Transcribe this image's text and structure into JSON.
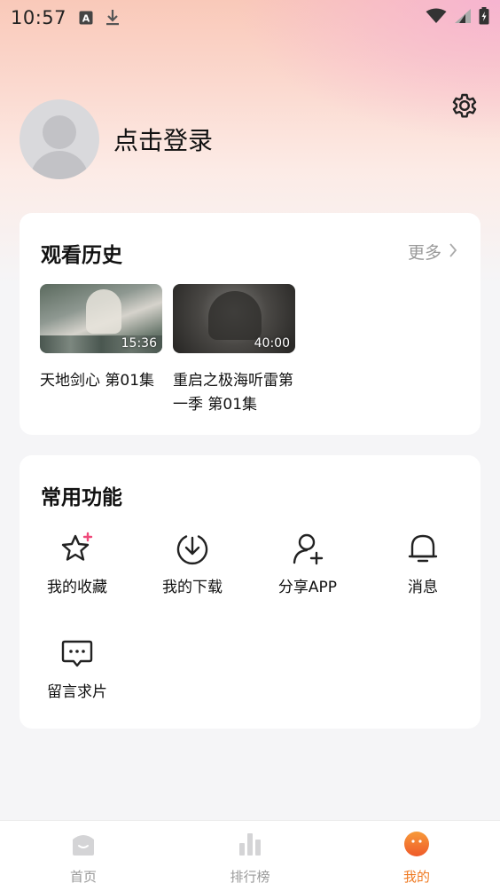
{
  "status_bar": {
    "time": "10:57",
    "icons": [
      "text-a-icon",
      "download-icon",
      "wifi-icon",
      "signal-icon",
      "battery-icon"
    ]
  },
  "profile": {
    "login_text": "点击登录"
  },
  "history": {
    "title": "观看历史",
    "more_label": "更多",
    "items": [
      {
        "title": "天地剑心 第01集",
        "duration": "15:36"
      },
      {
        "title": "重启之极海听雷第一季 第01集",
        "duration": "40:00"
      }
    ]
  },
  "functions": {
    "title": "常用功能",
    "items": [
      {
        "label": "我的收藏",
        "icon": "star-icon"
      },
      {
        "label": "我的下载",
        "icon": "download-circle-icon"
      },
      {
        "label": "分享APP",
        "icon": "add-user-icon"
      },
      {
        "label": "消息",
        "icon": "bell-icon"
      },
      {
        "label": "留言求片",
        "icon": "chat-bubble-icon"
      }
    ]
  },
  "bottom_nav": {
    "items": [
      {
        "label": "首页",
        "icon": "home-icon",
        "active": false
      },
      {
        "label": "排行榜",
        "icon": "ranking-icon",
        "active": false
      },
      {
        "label": "我的",
        "icon": "mine-icon",
        "active": true
      }
    ]
  },
  "colors": {
    "accent": "#ef7a22",
    "inactive": "#999999"
  }
}
